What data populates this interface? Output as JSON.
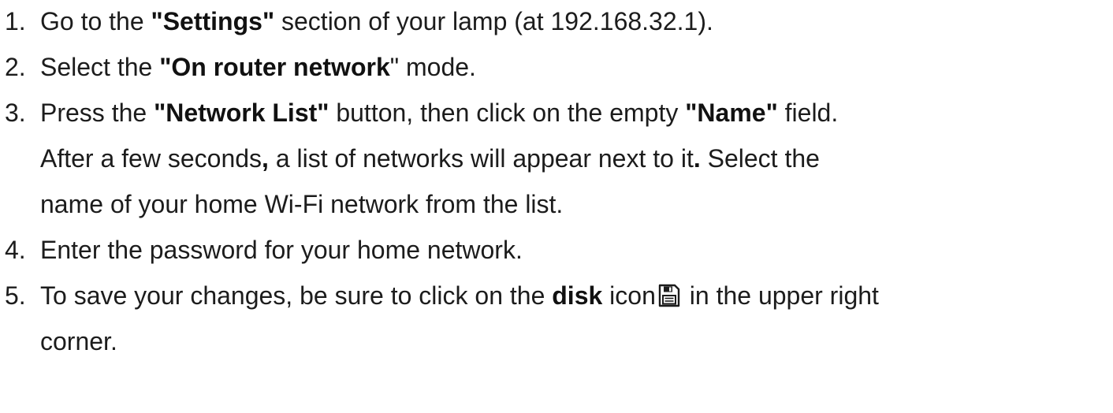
{
  "steps": [
    {
      "number": "1.",
      "pre": "Go to the ",
      "bold": "\"Settings\"",
      "post": " section of your lamp (at 192.168.32.1)."
    },
    {
      "number": "2.",
      "pre": "Select the ",
      "bold": "\"On router network",
      "post": "\" mode."
    },
    {
      "number": "3.",
      "pre": "Press the ",
      "bold1": "\"Network List\"",
      "mid": " button, then click on the empty ",
      "bold2": "\"Name\"",
      "post": " field.",
      "line2a": "After a few seconds",
      "line2comma": ",",
      "line2b": " a list of networks will appear next to it",
      "line2dot": ".",
      "line2c": " Select the",
      "line3": "name of your home Wi-Fi network from the list."
    },
    {
      "number": "4.",
      "text": "Enter the password for your home network."
    },
    {
      "number": "5.",
      "pre": "To save your changes, be sure to click on the ",
      "bold": "disk",
      "mid": " icon",
      "icon": "floppy-disk-icon",
      "post": " in the upper right",
      "line2": "corner."
    }
  ]
}
